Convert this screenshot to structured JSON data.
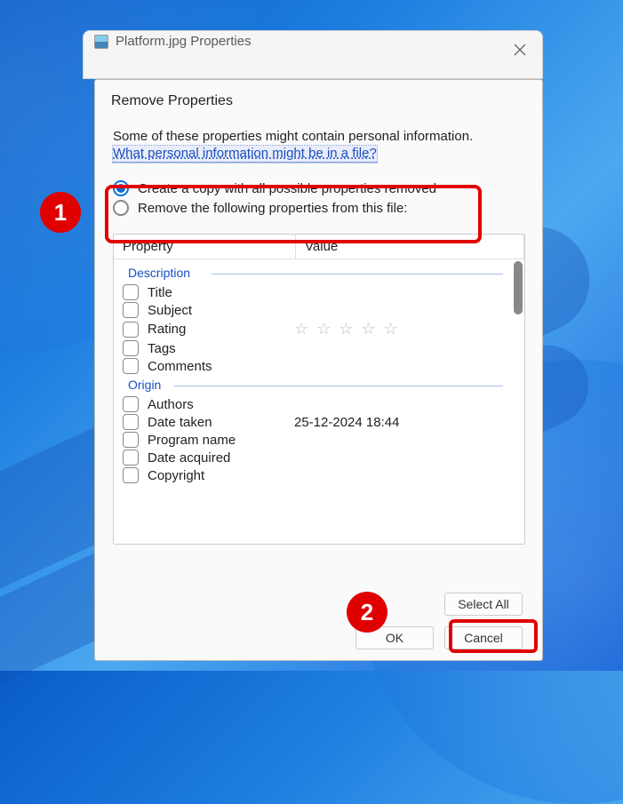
{
  "window": {
    "title": "Platform.jpg Properties"
  },
  "dialog": {
    "title": "Remove Properties",
    "info_text": "Some of these properties might contain personal information.",
    "help_link": "What personal information might be in a file?",
    "radio": {
      "option1": "Create a copy with all possible properties removed",
      "option2": "Remove the following properties from this file:"
    },
    "headers": {
      "property": "Property",
      "value": "Value"
    },
    "groups": {
      "description": "Description",
      "origin": "Origin"
    },
    "properties": {
      "title": "Title",
      "subject": "Subject",
      "rating": "Rating",
      "tags": "Tags",
      "comments": "Comments",
      "authors": "Authors",
      "date_taken": "Date taken",
      "date_taken_value": "25-12-2024 18:44",
      "program_name": "Program name",
      "date_acquired": "Date acquired",
      "copyright": "Copyright"
    },
    "rating_stars": "☆ ☆ ☆ ☆ ☆",
    "buttons": {
      "select_all": "Select All",
      "ok": "OK",
      "cancel": "Cancel"
    }
  },
  "annotations": {
    "one": "1",
    "two": "2"
  }
}
